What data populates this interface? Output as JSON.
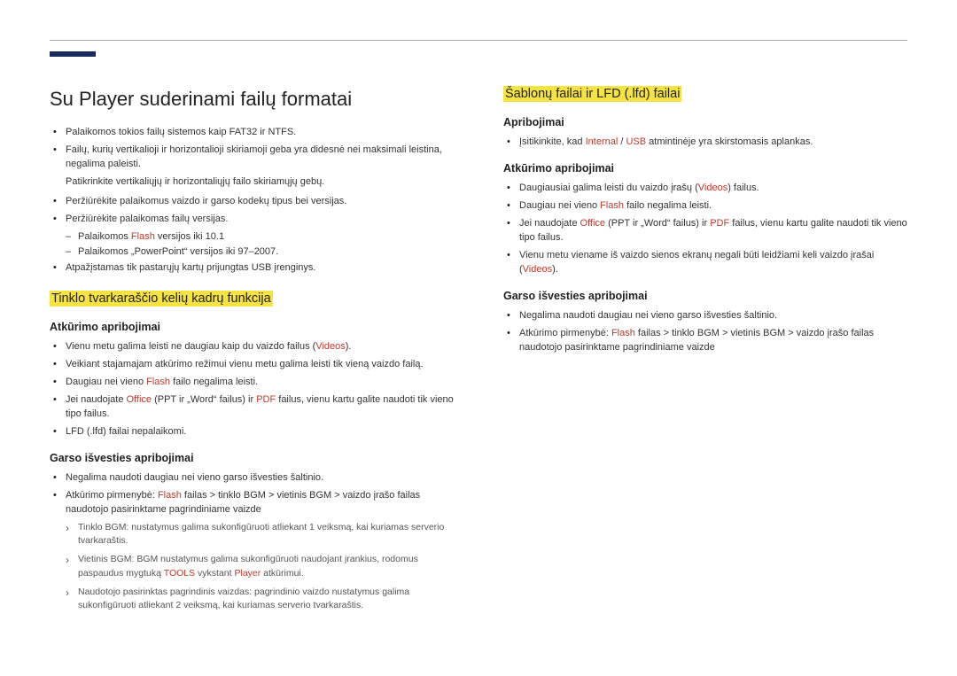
{
  "left": {
    "h1": "Su Player suderinami failų formatai",
    "intro_bullets": [
      "Palaikomos tokios failų sistemos kaip FAT32 ir NTFS.",
      "Failų, kurių vertikalioji ir horizontalioji skiriamoji geba yra didesnė nei maksimali leistina, negalima paleisti."
    ],
    "intro_indent": "Patikrinkite vertikaliųjų ir horizontaliųjų failo skiriamųjų gebų.",
    "intro_bullets2": [
      "Peržiūrėkite palaikomus vaizdo ir garso kodekų tipus bei versijas.",
      "Peržiūrėkite palaikomas failų versijas."
    ],
    "dash_items": [
      {
        "pre": "Palaikomos ",
        "red": "Flash",
        "post": " versijos iki 10.1"
      },
      {
        "pre": "Palaikomos „PowerPoint“ versijos iki 97–2007."
      }
    ],
    "intro_bullets3": [
      "Atpažįstamas tik pastarųjų kartų prijungtas USB įrenginys."
    ],
    "section1_title": "Tinklo tvarkaraščio kelių kadrų funkcija",
    "sub_play_title": "Atkūrimo apribojimai",
    "play_bullets": [
      {
        "pre": "Vienu metu galima leisti ne daugiau kaip du vaizdo failus (",
        "red": "Videos",
        "post": ")."
      },
      {
        "pre": "Veikiant stajamajam atkūrimo režimui vienu metu galima leisti tik vieną vaizdo failą."
      },
      {
        "pre": "Daugiau nei vieno ",
        "red": "Flash",
        "post": " failo negalima leisti."
      },
      {
        "pre": "Jei naudojate ",
        "red": "Office",
        "post": " (PPT ir „Word“ failus) ir ",
        "red2": "PDF",
        "post2": " failus, vienu kartu galite naudoti tik vieno tipo failus."
      },
      {
        "pre": "LFD (.lfd) failai nepalaikomi."
      }
    ],
    "sub_audio_title": "Garso išvesties apribojimai",
    "audio_bullets": [
      {
        "pre": "Negalima naudoti daugiau nei vieno garso išvesties šaltinio."
      },
      {
        "pre": "Atkūrimo pirmenybė: ",
        "red": "Flash",
        "post": " failas > tinklo BGM > vietinis BGM > vaizdo įrašo failas naudotojo pasirinktame pagrindiniame vaizde"
      }
    ],
    "arrows": [
      "Tinklo BGM: nustatymus galima sukonfigūruoti atliekant 1 veiksmą, kai kuriamas serverio tvarkaraštis.",
      {
        "pre": "Vietinis BGM: BGM nustatymus galima sukonfigūruoti naudojant įrankius, rodomus paspaudus mygtuką ",
        "red": "TOOLS",
        "post": " vykstant ",
        "red2": "Player",
        "post2": " atkūrimui."
      },
      "Naudotojo pasirinktas pagrindinis vaizdas: pagrindinio vaizdo nustatymus galima sukonfigūruoti atliekant 2 veiksmą, kai kuriamas serverio tvarkaraštis."
    ]
  },
  "right": {
    "section2_title": "Šablonų failai ir LFD (.lfd) failai",
    "sub_restrict_title": "Apribojimai",
    "restrict_bullets": [
      {
        "pre": "Įsitikinkite, kad ",
        "red": "Internal",
        "post": " / ",
        "red2": "USB",
        "post2": " atmintinėje yra skirstomasis aplankas."
      }
    ],
    "sub_play_title": "Atkūrimo apribojimai",
    "play_bullets": [
      {
        "pre": "Daugiausiai galima leisti du vaizdo įrašų (",
        "red": "Videos",
        "post": ") failus."
      },
      {
        "pre": "Daugiau nei vieno ",
        "red": "Flash",
        "post": " failo negalima leisti."
      },
      {
        "pre": "Jei naudojate ",
        "red": "Office",
        "post": " (PPT ir „Word“ failus) ir ",
        "red2": "PDF",
        "post2": " failus, vienu kartu galite naudoti tik vieno tipo failus."
      },
      {
        "pre": "Vienu metu viename iš vaizdo sienos ekranų negali būti leidžiami keli vaizdo įrašai (",
        "red": "Videos",
        "post": ")."
      }
    ],
    "sub_audio_title": "Garso išvesties apribojimai",
    "audio_bullets": [
      {
        "pre": "Negalima naudoti daugiau nei vieno garso išvesties šaltinio."
      },
      {
        "pre": "Atkūrimo pirmenybė: ",
        "red": "Flash",
        "post": " failas > tinklo BGM > vietinis BGM > vaizdo įrašo failas naudotojo pasirinktame pagrindiniame vaizde"
      }
    ]
  }
}
